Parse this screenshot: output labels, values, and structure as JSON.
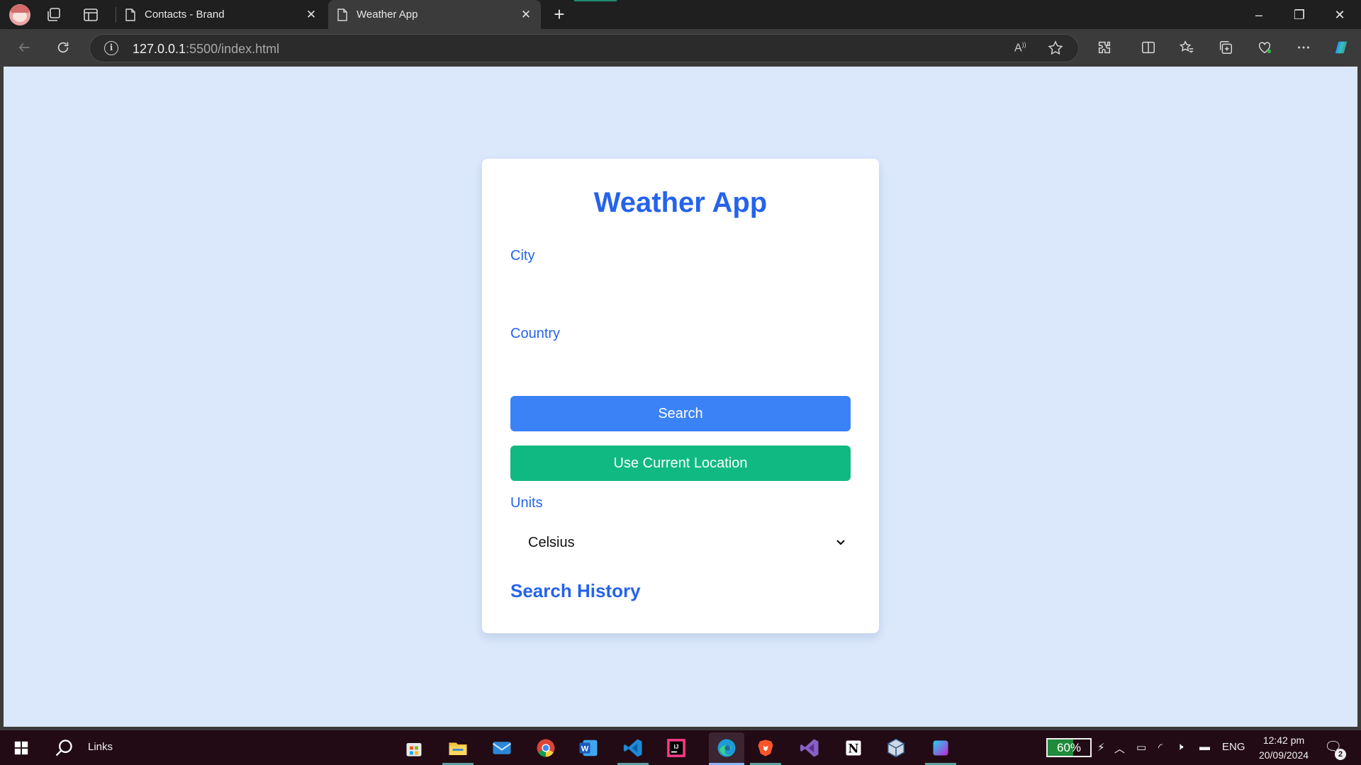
{
  "browser": {
    "tabs": [
      {
        "title": "Contacts - Brand"
      },
      {
        "title": "Weather App"
      }
    ],
    "address": {
      "host": "127.0.0.1",
      "path": ":5500/index.html"
    }
  },
  "page": {
    "title": "Weather App",
    "city_label": "City",
    "city_value": "",
    "country_label": "Country",
    "country_value": "",
    "search_button": "Search",
    "location_button": "Use Current Location",
    "units_label": "Units",
    "units_selected": "Celsius",
    "history_heading": "Search History"
  },
  "taskbar": {
    "search_label": "Links",
    "battery_percent": "60%",
    "battery_level": 0.6,
    "language": "ENG",
    "time": "12:42 pm",
    "date": "20/09/2024",
    "notification_count": "2"
  },
  "colors": {
    "accent": "#2563eb",
    "search_button": "#3b82f6",
    "location_button": "#10b981",
    "page_background": "#dbe8fc"
  }
}
